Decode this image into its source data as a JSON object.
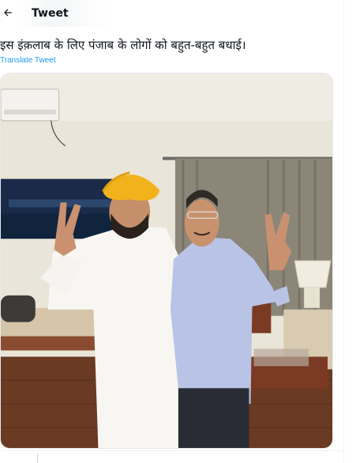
{
  "header": {
    "back_icon": "arrow-left-icon",
    "title": "Tweet"
  },
  "tweet": {
    "text": "इस इंक़लाब के लिए पंजाब के लोगों को बहुत-बहुत बधाई।",
    "translate_label": "Translate Tweet"
  },
  "media": {
    "photo_icon": "tweet-photo"
  },
  "colors": {
    "accent": "#1d9bf0",
    "text": "#0f1419",
    "border": "#eff3f4"
  }
}
